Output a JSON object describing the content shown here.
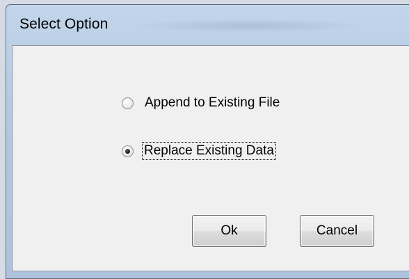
{
  "dialog": {
    "title": "Select Option"
  },
  "options": [
    {
      "label": "Append to Existing File",
      "checked": false
    },
    {
      "label": "Replace Existing Data",
      "checked": true
    }
  ],
  "buttons": {
    "ok_label": "Ok",
    "cancel_label": "Cancel"
  }
}
